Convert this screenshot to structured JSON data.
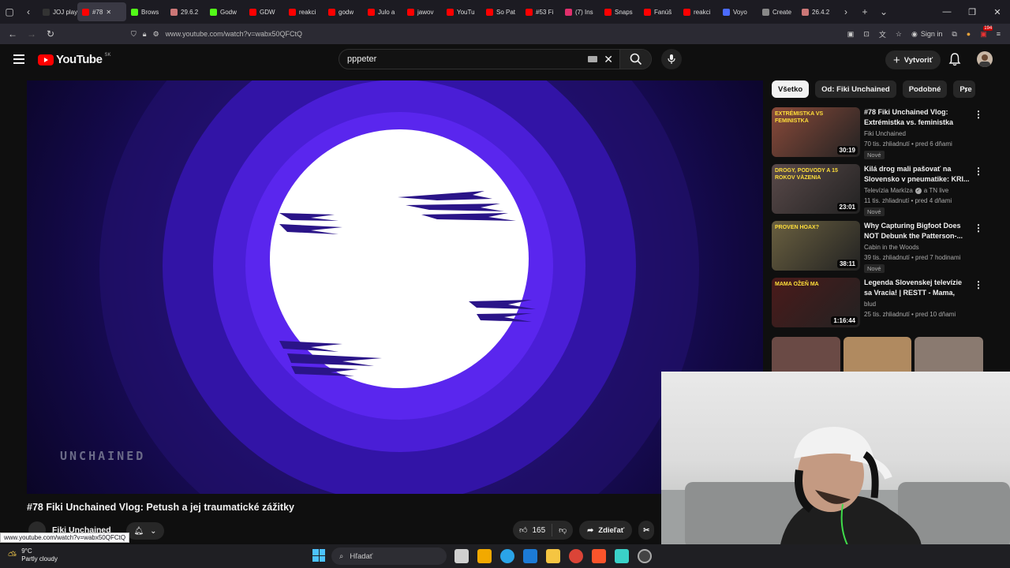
{
  "browser": {
    "tabs": [
      {
        "label": "JOJ play",
        "color": "#333"
      },
      {
        "label": "#78",
        "color": "#ff0000",
        "active": true
      },
      {
        "label": "Brows",
        "color": "#53fc18"
      },
      {
        "label": "29.6.2",
        "color": "#c77"
      },
      {
        "label": "Godw",
        "color": "#53fc18"
      },
      {
        "label": "GDW",
        "color": "#ff0000"
      },
      {
        "label": "reakci",
        "color": "#ff0000"
      },
      {
        "label": "godw",
        "color": "#ff0000"
      },
      {
        "label": "Julo a",
        "color": "#ff0000"
      },
      {
        "label": "jawov",
        "color": "#ff0000"
      },
      {
        "label": "YouTu",
        "color": "#ff0000"
      },
      {
        "label": "So Pat",
        "color": "#ff0000"
      },
      {
        "label": "#53 Fi",
        "color": "#ff0000"
      },
      {
        "label": "(7) Ins",
        "color": "#e1306c"
      },
      {
        "label": "Snaps",
        "color": "#ff0000"
      },
      {
        "label": "Fanúš",
        "color": "#ff0000"
      },
      {
        "label": "reakci",
        "color": "#ff0000"
      },
      {
        "label": "Voyo",
        "color": "#4b6bff"
      },
      {
        "label": "Create",
        "color": "#888"
      },
      {
        "label": "26.4.2",
        "color": "#c77"
      }
    ],
    "url": "www.youtube.com/watch?v=wabx50QFCtQ",
    "sign_in": "Sign in",
    "ext_badge": "194"
  },
  "header": {
    "logo_text": "YouTube",
    "country": "SK",
    "search_value": "pppeter",
    "create_label": "Vytvoriť"
  },
  "video": {
    "watermark": "UNCHAINED",
    "title": "#78 Fiki Unchained Vlog: Petush a jej traumatické zážitky",
    "channel": "Fiki Unchained",
    "likes": "165",
    "share_label": "Zdieľať"
  },
  "chips": [
    "Všetko",
    "Od: Fiki Unchained",
    "Podobné",
    "Pre"
  ],
  "recommendations": [
    {
      "title": "#78 Fiki Unchained Vlog: Extrémistka vs. feministka",
      "channel": "Fiki Unchained",
      "meta": "70 tis. zhliadnutí • pred 6 dňami",
      "badge": "Nové",
      "duration": "30:19",
      "verified": false,
      "thumb_color": "#8a4a3a",
      "thumb_text": "EXTRÉMISTKA VS FEMINISTKA"
    },
    {
      "title": "Kilá drog mali pašovať na Slovensko v pneumatike: KRI...",
      "channel": "Televízia Markíza",
      "channel_extra": "a TN live",
      "meta": "11 tis. zhliadnutí • pred 4 dňami",
      "badge": "Nové",
      "duration": "23:01",
      "verified": true,
      "thumb_color": "#5a4a4a",
      "thumb_text": "DROGY, PODVODY A 15 ROKOV VÄZENIA"
    },
    {
      "title": "Why Capturing Bigfoot Does NOT Debunk the Patterson-...",
      "channel": "Cabin in the Woods",
      "meta": "39 tis. zhliadnutí • pred 7 hodinami",
      "badge": "Nové",
      "duration": "38:11",
      "verified": false,
      "thumb_color": "#6a6040",
      "thumb_text": "PROVEN HOAX?"
    },
    {
      "title": "Legenda Slovenskej televízie sa Vracia! | RESTT - Mama, ožeň ...",
      "channel": "blud",
      "meta": "25 tis. zhliadnutí • pred 10 dňami",
      "badge": "",
      "duration": "1:16:44",
      "verified": false,
      "thumb_color": "#4a1a1a",
      "thumb_text": "MAMA OŽEŇ MA"
    }
  ],
  "status_link": "www.youtube.com/watch?v=wabx50QFCtQ",
  "taskbar": {
    "temp": "9°C",
    "weather": "Partly cloudy",
    "search_placeholder": "Hľadať"
  }
}
